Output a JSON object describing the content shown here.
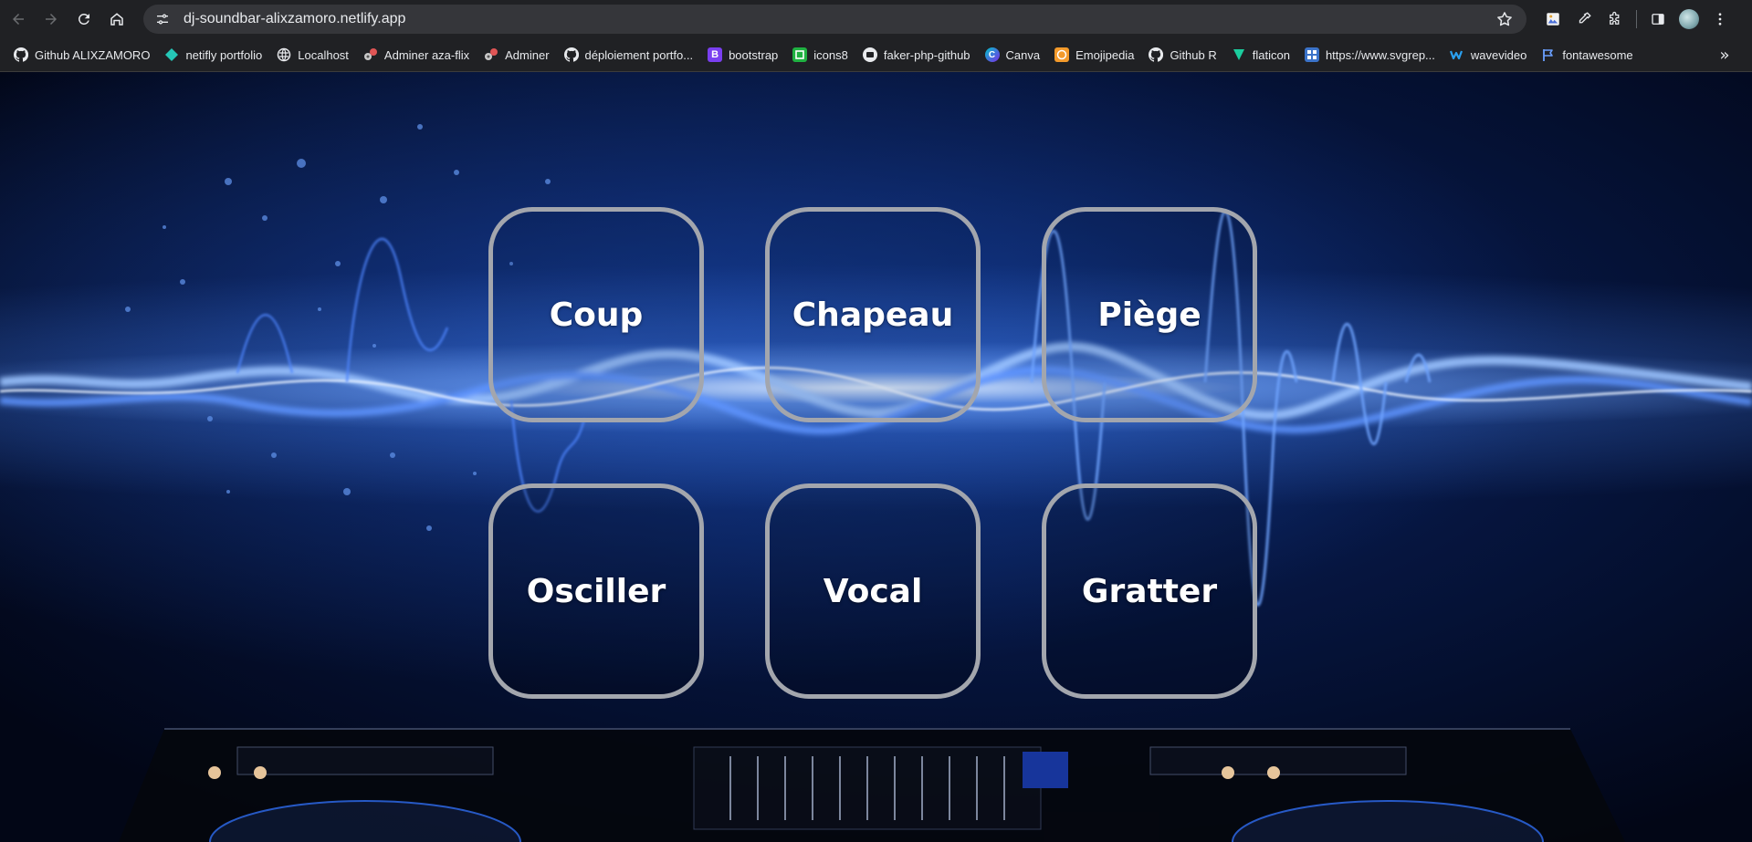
{
  "browser": {
    "url": "dj-soundbar-alixzamoro.netlify.app",
    "bookmarks": [
      {
        "label": "Github ALIXZAMORO",
        "icon": "github-icon"
      },
      {
        "label": "netifly portfolio",
        "icon": "netlify-icon"
      },
      {
        "label": "Localhost",
        "icon": "globe-icon"
      },
      {
        "label": "Adminer aza-flix",
        "icon": "adminer-icon"
      },
      {
        "label": "Adminer",
        "icon": "adminer-icon"
      },
      {
        "label": "déploiement portfo...",
        "icon": "github-icon"
      },
      {
        "label": "bootstrap",
        "icon": "bootstrap-icon"
      },
      {
        "label": "icons8",
        "icon": "icons8-icon"
      },
      {
        "label": "faker-php-github",
        "icon": "faker-icon"
      },
      {
        "label": "Canva",
        "icon": "canva-icon"
      },
      {
        "label": "Emojipedia",
        "icon": "emojipedia-icon"
      },
      {
        "label": "Github R",
        "icon": "github-icon"
      },
      {
        "label": "flaticon",
        "icon": "flaticon-icon"
      },
      {
        "label": "https://www.svgrep...",
        "icon": "svgrepo-icon"
      },
      {
        "label": "wavevideo",
        "icon": "wavevideo-icon"
      },
      {
        "label": "fontawesome",
        "icon": "fontawesome-icon"
      }
    ],
    "colors": {
      "chrome_bg": "#202124",
      "omnibox_bg": "#35363a",
      "text": "#e8eaed"
    }
  },
  "soundboard": {
    "pads": [
      {
        "label": "Coup"
      },
      {
        "label": "Chapeau"
      },
      {
        "label": "Piège"
      },
      {
        "label": "Osciller"
      },
      {
        "label": "Vocal"
      },
      {
        "label": "Gratter"
      }
    ],
    "colors": {
      "pad_border": "#a3a6ad",
      "pad_text": "#ffffff",
      "background_accent": "#1e5bd8"
    }
  }
}
